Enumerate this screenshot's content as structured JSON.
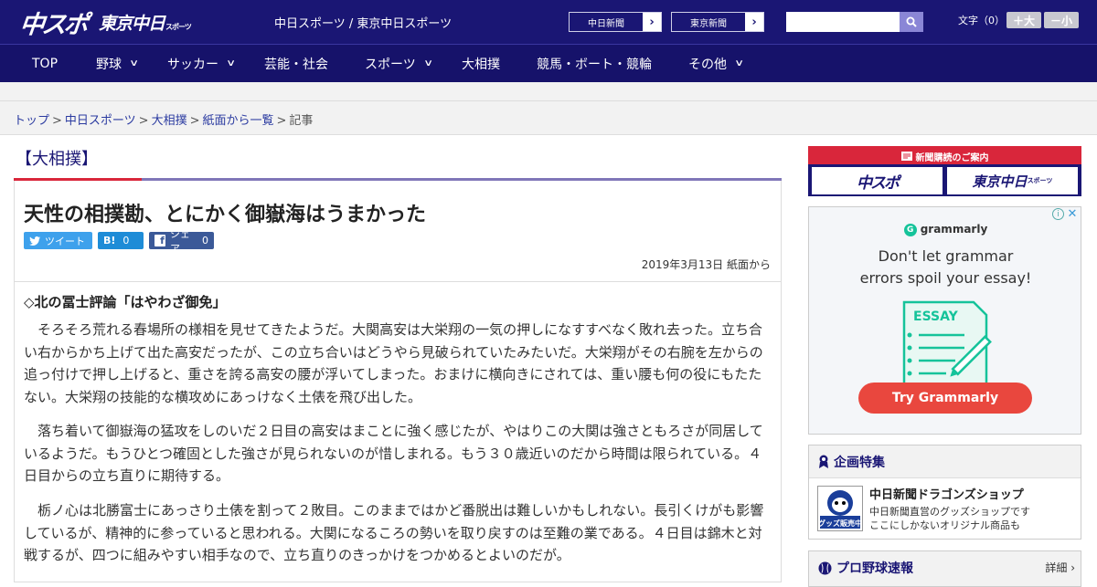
{
  "header": {
    "logo_main": "中スポ",
    "logo_sub": "東京中日",
    "logo_sub_small": "スポーツ",
    "tagline": "中日スポーツ / 東京中日スポーツ",
    "links": [
      {
        "label": "中日新聞",
        "arrow": "›"
      },
      {
        "label": "東京新聞",
        "arrow": "›"
      }
    ],
    "search_placeholder": "",
    "font_size": {
      "label": "文字（0）",
      "larger": "＋大",
      "smaller": "－小"
    }
  },
  "nav": [
    {
      "label": "TOP",
      "chev": ""
    },
    {
      "label": "野球",
      "chev": "∨"
    },
    {
      "label": "サッカー",
      "chev": "∨"
    },
    {
      "label": "芸能・社会",
      "chev": ""
    },
    {
      "label": "スポーツ",
      "chev": "∨"
    },
    {
      "label": "大相撲",
      "chev": ""
    },
    {
      "label": "競馬・ボート・競輪",
      "chev": ""
    },
    {
      "label": "その他",
      "chev": "∨"
    }
  ],
  "breadcrumb": {
    "items": [
      "トップ",
      "中日スポーツ",
      "大相撲",
      "紙面から一覧"
    ],
    "current": "記事",
    "sep": ">"
  },
  "article": {
    "category": "【大相撲】",
    "title": "天性の相撲勘、とにかく御嶽海はうまかった",
    "share": {
      "tweet": "ツイート",
      "hatena": "0",
      "hatena_icon": "B!",
      "fb": "シェア",
      "fb_count": "0",
      "fb_icon": "f"
    },
    "pubdate": "2019年3月13日 紙面から",
    "subhead": "◇北の冨士評論「はやわざ御免」",
    "paragraphs": [
      "そろそろ荒れる春場所の様相を見せてきたようだ。大関高安は大栄翔の一気の押しになすすべなく敗れ去った。立ち合い右からかち上げて出た高安だったが、この立ち合いはどうやら見破られていたみたいだ。大栄翔がその右腕を左からの追っ付けで押し上げると、重さを誇る高安の腰が浮いてしまった。おまけに横向きにされては、重い腰も何の役にもたたない。大栄翔の技能的な横攻めにあっけなく土俵を飛び出した。",
      "落ち着いて御嶽海の猛攻をしのいだ２日目の高安はまことに強く感じたが、やはりこの大関は強さともろさが同居しているようだ。もうひとつ確固とした強さが見られないのが惜しまれる。もう３０歳近いのだから時間は限られている。４日目からの立ち直りに期待する。",
      "栃ノ心は北勝富士にあっさり土俵を割って２敗目。このままではかど番脱出は難しいかもしれない。長引くけがも影響しているが、精神的に参っていると思われる。大関になるころの勢いを取り戻すのは至難の業である。４日目は錦木と対戦するが、四つに組みやすい相手なので、立ち直りのきっかけをつかめるとよいのだが。"
    ]
  },
  "sidebar": {
    "subscribe": {
      "head": "新聞購読のご案内",
      "logo1": "中スポ",
      "logo2": "東京中日",
      "logo2_small": "スポーツ"
    },
    "ad": {
      "brand": "grammarly",
      "brand_mark": "G",
      "line1": "Don't let grammar",
      "line2": "errors spoil your essay!",
      "essay": "ESSAY",
      "cta": "Try Grammarly",
      "info": "i",
      "close": "✕"
    },
    "feature": {
      "head": "企画特集",
      "title": "中日新聞ドラゴンズショップ",
      "desc1": "中日新聞直営のグッズショップです",
      "desc2": "ここにしかないオリジナル商品も",
      "thumb_text": "グッズ販売中"
    },
    "scores": {
      "head": "プロ野球速報",
      "more": "詳細 ›"
    }
  },
  "colors": {
    "brand_navy": "#1a1674",
    "accent_red": "#d9263b",
    "link_blue": "#2a3aa0"
  }
}
